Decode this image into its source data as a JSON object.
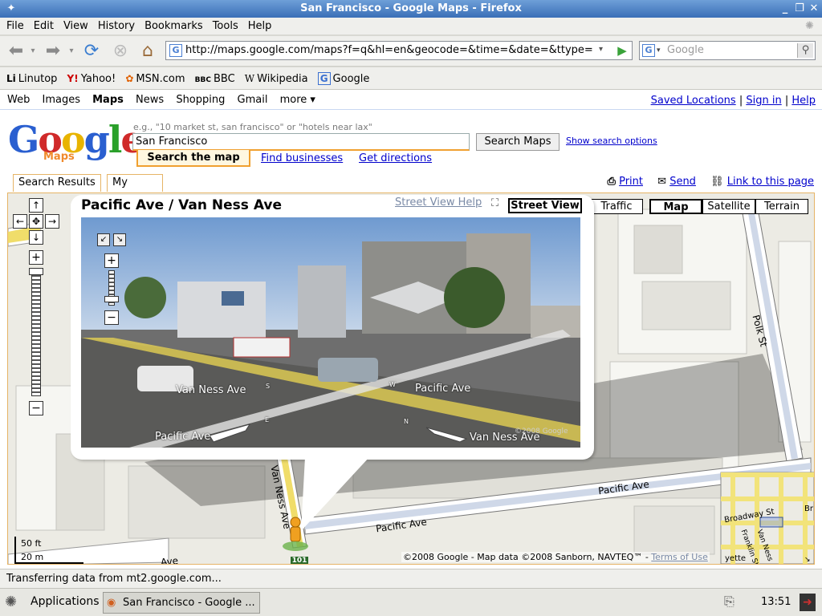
{
  "window": {
    "title": "San Francisco - Google Maps - Firefox"
  },
  "menu": [
    "File",
    "Edit",
    "View",
    "History",
    "Bookmarks",
    "Tools",
    "Help"
  ],
  "nav": {
    "url": "http://maps.google.com/maps?f=q&hl=en&geocode=&time=&date=&ttype=",
    "search_placeholder": "Google"
  },
  "bookmarks": [
    {
      "icon": "Li",
      "label": "Linutop"
    },
    {
      "icon": "Y!",
      "label": "Yahoo!"
    },
    {
      "icon": "✿",
      "label": "MSN.com"
    },
    {
      "icon": "BBC",
      "label": "BBC"
    },
    {
      "icon": "W",
      "label": "Wikipedia"
    },
    {
      "icon": "G",
      "label": "Google"
    }
  ],
  "gbar": {
    "left": [
      "Web",
      "Images",
      "Maps",
      "News",
      "Shopping",
      "Gmail",
      "more ▾"
    ],
    "saved": "Saved Locations",
    "signin": "Sign in",
    "help": "Help",
    "sep": "|"
  },
  "logo": {
    "text": "Google",
    "sub": "Maps"
  },
  "search": {
    "hint": "e.g., \"10 market st, san francisco\" or \"hotels near lax\"",
    "value": "San Francisco",
    "button": "Search Maps",
    "options": "Show search options",
    "tab_active": "Search the map",
    "find_businesses": "Find businesses",
    "get_directions": "Get directions"
  },
  "panel_tabs": {
    "results": "Search Results",
    "mymaps": "My Maps"
  },
  "tools": {
    "print": "Print",
    "send": "Send",
    "link": "Link to this page"
  },
  "map_buttons": {
    "traffic": "Traffic",
    "map": "Map",
    "satellite": "Satellite",
    "terrain": "Terrain"
  },
  "bubble": {
    "title": "Pacific Ave / Van Ness Ave",
    "help": "Street View Help",
    "street_view": "Street View",
    "labels": {
      "van_ness_left": "Van Ness Ave",
      "pacific_right": "Pacific Ave",
      "pacific_left": "Pacific Ave",
      "van_ness_right": "Van Ness Ave",
      "dir_s": "S",
      "dir_w": "W",
      "dir_e": "E",
      "dir_n": "N",
      "watermark": "©2008 Google"
    }
  },
  "map_labels": {
    "polk": "Polk St",
    "pacific1": "Pacific Ave",
    "pacific2": "Pacific Ave",
    "van_ness": "Van Ness Ave",
    "route": "101",
    "scale_ft": "50 ft",
    "scale_m": "20 m",
    "bottom_left": "Ave",
    "copyright": "©2008 Google - Map data ©2008 Sanborn, NAVTEQ™ -",
    "terms": "Terms of Use",
    "mini": {
      "broadway": "Broadway St",
      "franklin": "Franklin St",
      "van_ness": "Van Ness",
      "br": "Br",
      "yette": "yette"
    }
  },
  "status": "Transferring data from mt2.google.com...",
  "taskbar": {
    "apps": "Applications",
    "task": "San Francisco - Google ...",
    "clock": "13:51"
  }
}
